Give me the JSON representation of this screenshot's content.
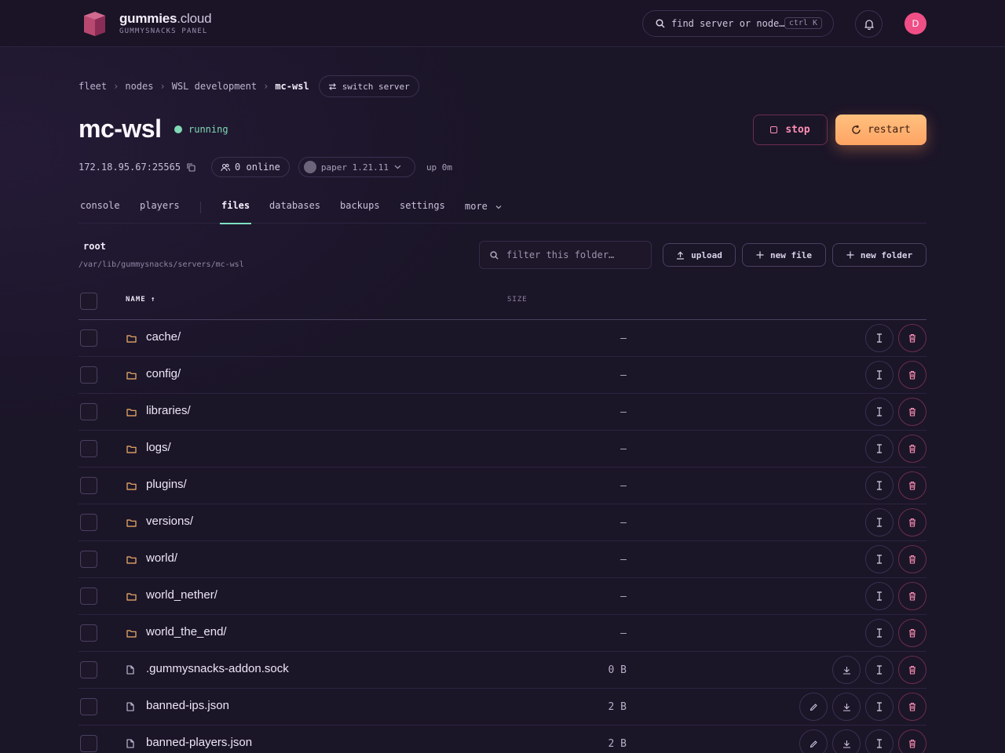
{
  "header": {
    "brand_main": "gummies",
    "brand_suffix": ".cloud",
    "brand_sub": "GUMMYSNACKS PANEL",
    "search_placeholder": "find server or node…",
    "search_shortcut": "ctrl K",
    "avatar_initial": "D"
  },
  "breadcrumb": {
    "items": [
      "fleet",
      "nodes",
      "WSL development"
    ],
    "current": "mc-wsl",
    "switch_label": "switch server"
  },
  "server": {
    "name": "mc-wsl",
    "status": "running",
    "address": "172.18.95.67:25565",
    "players_online": "0 online",
    "version": "paper 1.21.11",
    "uptime": "up 0m",
    "stop_label": "stop",
    "restart_label": "restart"
  },
  "tabs": [
    "console",
    "players",
    "files",
    "databases",
    "backups",
    "settings",
    "more"
  ],
  "active_tab": "files",
  "files": {
    "root_label": "root",
    "root_path": "/var/lib/gummysnacks/servers/mc-wsl",
    "filter_placeholder": "filter this folder…",
    "upload_label": "upload",
    "new_file_label": "new file",
    "new_folder_label": "new folder",
    "col_name": "NAME ↑",
    "col_size": "SIZE",
    "rows": [
      {
        "name": "cache/",
        "size": "–",
        "type": "folder"
      },
      {
        "name": "config/",
        "size": "–",
        "type": "folder"
      },
      {
        "name": "libraries/",
        "size": "–",
        "type": "folder"
      },
      {
        "name": "logs/",
        "size": "–",
        "type": "folder"
      },
      {
        "name": "plugins/",
        "size": "–",
        "type": "folder"
      },
      {
        "name": "versions/",
        "size": "–",
        "type": "folder"
      },
      {
        "name": "world/",
        "size": "–",
        "type": "folder"
      },
      {
        "name": "world_nether/",
        "size": "–",
        "type": "folder"
      },
      {
        "name": "world_the_end/",
        "size": "–",
        "type": "folder"
      },
      {
        "name": ".gummysnacks-addon.sock",
        "size": "0 B",
        "type": "file"
      },
      {
        "name": "banned-ips.json",
        "size": "2 B",
        "type": "file"
      },
      {
        "name": "banned-players.json",
        "size": "2 B",
        "type": "file"
      }
    ]
  },
  "colors": {
    "accent_teal": "#7ee0c0",
    "status_running": "#7fd9b4",
    "danger": "#ff8fb4",
    "restart": "#ffb070",
    "folder": "#f5b26b",
    "avatar": "#ef4f86"
  }
}
